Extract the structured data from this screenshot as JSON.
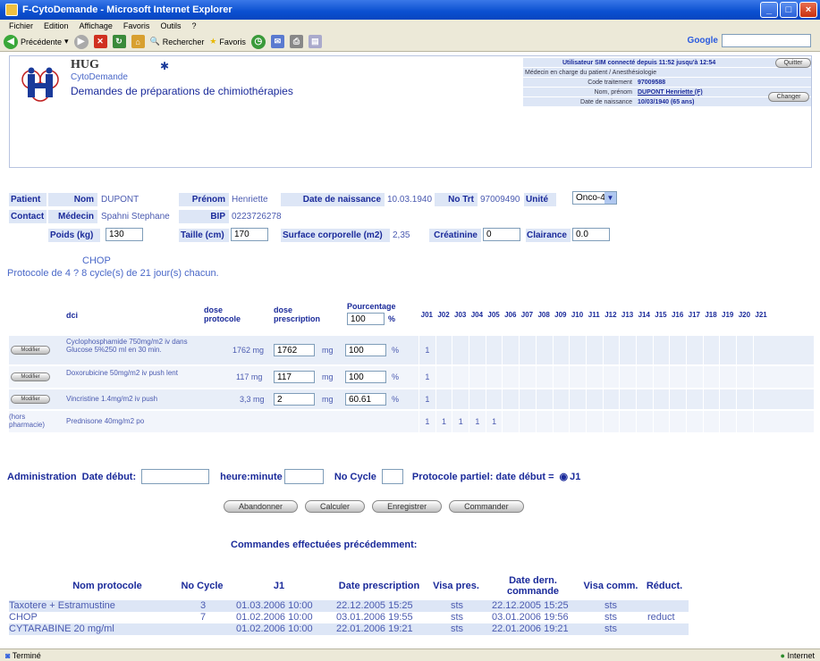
{
  "window": {
    "title": "F-CytoDemande - Microsoft Internet Explorer"
  },
  "menu": [
    "Fichier",
    "Edition",
    "Affichage",
    "Favoris",
    "Outils",
    "?"
  ],
  "toolbar": {
    "back": "Précédente",
    "search": "Rechercher",
    "favorites": "Favoris",
    "google": "Google"
  },
  "status": {
    "left": "Terminé",
    "right": "Internet"
  },
  "header": {
    "hug": "HUG",
    "cyto": "CytoDemande",
    "title": "Demandes de préparations de chimiothérapies",
    "user_line": "Utilisateur SIM connecté depuis 11:52 jusqu'à 12:54",
    "medecin_line": "Médecin en charge du patient / Anesthésiologie",
    "code_label": "Code traitement",
    "code_value": "97009588",
    "nom_label": "Nom, prénom",
    "nom_value": "DUPONT Henriette (F)",
    "dob_label": "Date de naissance",
    "dob_value": "10/03/1940 (65 ans)",
    "quitter": "Quitter",
    "changer": "Changer"
  },
  "patient": {
    "patient_label": "Patient",
    "nom_label": "Nom",
    "nom": "DUPONT",
    "prenom_label": "Prénom",
    "prenom": "Henriette",
    "dob_label": "Date de naissance",
    "dob": "10.03.1940",
    "nott_label": "No Trt",
    "nott": "97009490",
    "unite_label": "Unité",
    "unite": "Onco-4",
    "contact_label": "Contact",
    "medecin_label": "Médecin",
    "medecin": "Spahni Stephane",
    "bip_label": "BIP",
    "bip": "0223726278",
    "poids_label": "Poids (kg)",
    "poids": "130",
    "taille_label": "Taille (cm)",
    "taille": "170",
    "surface_label": "Surface corporelle (m2)",
    "surface": "2,35",
    "creat_label": "Créatinine",
    "creat": "0",
    "clair_label": "Clairance",
    "clair": "0.0"
  },
  "protocol": {
    "name": "CHOP",
    "desc": "Protocole de 4 ? 8 cycle(s) de 21 jour(s) chacun."
  },
  "treatment": {
    "h_dci": "dci",
    "h_dose_proto": "dose protocole",
    "h_dose_presc": "dose prescription",
    "h_pct": "Pourcentage",
    "pct_value": "100",
    "pct_sign": "%",
    "days": [
      "J01",
      "J02",
      "J03",
      "J04",
      "J05",
      "J06",
      "J07",
      "J08",
      "J09",
      "J10",
      "J11",
      "J12",
      "J13",
      "J14",
      "J15",
      "J16",
      "J17",
      "J18",
      "J19",
      "J20",
      "J21"
    ],
    "modifier": "Modifier",
    "hors": "(hors pharmacie)",
    "rows": [
      {
        "dci": "Cyclophosphamide 750mg/m2 iv dans Glucose 5%250 ml en 30 min.",
        "dose_proto": "1762 mg",
        "dose_presc": "1762",
        "unit": "mg",
        "pct": "100",
        "sign": "%",
        "marks": [
          "1"
        ]
      },
      {
        "dci": "Doxorubicine 50mg/m2 iv push lent",
        "dose_proto": "117 mg",
        "dose_presc": "117",
        "unit": "mg",
        "pct": "100",
        "sign": "%",
        "marks": [
          "1"
        ]
      },
      {
        "dci": "Vincristine 1.4mg/m2 iv push",
        "dose_proto": "3,3 mg",
        "dose_presc": "2",
        "unit": "mg",
        "pct": "60.61",
        "sign": "%",
        "marks": [
          "1"
        ]
      },
      {
        "dci": "Prednisone 40mg/m2 po",
        "marks": [
          "1",
          "1",
          "1",
          "1",
          "1"
        ]
      }
    ]
  },
  "admin": {
    "label": "Administration",
    "date_debut": "Date début:",
    "heure": "heure:minute",
    "cycle": "No Cycle",
    "partiel": "Protocole partiel: date début =",
    "j1": "J1"
  },
  "buttons": {
    "abandonner": "Abandonner",
    "calculer": "Calculer",
    "enregistrer": "Enregistrer",
    "commander": "Commander"
  },
  "previous": {
    "title": "Commandes effectuées précédemment:",
    "headers": [
      "Nom protocole",
      "No Cycle",
      "J1",
      "Date prescription",
      "Visa pres.",
      "Date dern. commande",
      "Visa comm.",
      "Réduct."
    ],
    "rows": [
      [
        "Taxotere + Estramustine",
        "3",
        "01.03.2006 10:00",
        "22.12.2005 15:25",
        "sts",
        "22.12.2005 15:25",
        "sts",
        ""
      ],
      [
        "CHOP",
        "7",
        "01.02.2006 10:00",
        "03.01.2006 19:55",
        "sts",
        "03.01.2006 19:56",
        "sts",
        "reduct"
      ],
      [
        "CYTARABINE 20 mg/ml",
        "",
        "01.02.2006 10:00",
        "22.01.2006 19:21",
        "sts",
        "22.01.2006 19:21",
        "sts",
        ""
      ]
    ]
  }
}
